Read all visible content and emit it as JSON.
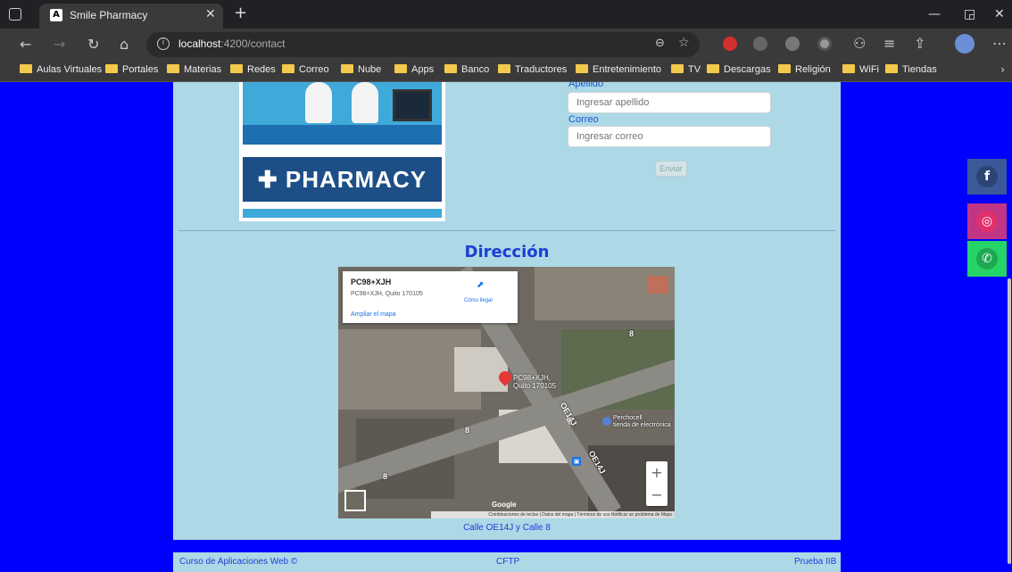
{
  "browser": {
    "tab_title": "Smile Pharmacy",
    "tab_favicon_letter": "A",
    "url_host": "localhost",
    "url_path": ":4200/contact",
    "bookmarks": [
      "Aulas Virtuales",
      "Portales",
      "Materias",
      "Redes",
      "Correo",
      "Nube",
      "Apps",
      "Banco",
      "Traductores",
      "Entretenimiento",
      "TV",
      "Descargas",
      "Religión",
      "WiFi",
      "Tiendas"
    ]
  },
  "image": {
    "sign_text": "PHARMACY"
  },
  "form": {
    "apellido_label": "Apellido",
    "apellido_placeholder": "Ingresar apellido",
    "correo_label": "Correo",
    "correo_placeholder": "Ingresar correo",
    "send_button": "Enviar"
  },
  "direccion": {
    "title": "Dirección",
    "map": {
      "place_code": "PC98+XJH",
      "place_address": "PC98+XJH, Quito 170105",
      "directions": "Cómo llegar",
      "enlarge": "Ampliar el mapa",
      "pin_label_1": "PC98+XJH,",
      "pin_label_2": "Quito 170105",
      "poi_label_1": "Perchocell",
      "poi_label_2": "tienda de electrónica",
      "street_a": "OE14J",
      "street_b": "OE14J",
      "street_8": "8",
      "zoom_in": "+",
      "zoom_out": "−",
      "google": "Google",
      "attribution": "Combinaciones de teclas | Datos del mapa | Términos de uso   Notificar un problema de Maps"
    },
    "caption": "Calle OE14J y Calle 8"
  },
  "social": {
    "facebook": "f",
    "instagram": "◎",
    "whatsapp": "✆",
    "colors": {
      "facebook": "#3b5998",
      "instagram": "#c13584",
      "whatsapp": "#25d366"
    }
  },
  "footer": {
    "left": "Curso de Aplicaciones Web ©",
    "center": "CFTP",
    "right": "Prueba IIB"
  }
}
